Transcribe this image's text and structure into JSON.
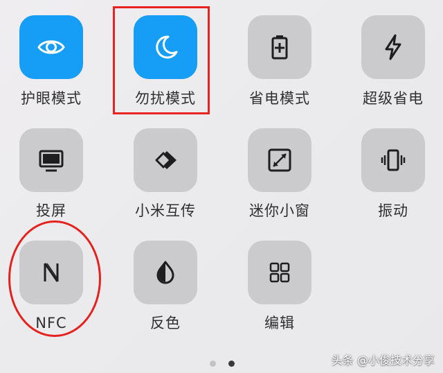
{
  "tiles": [
    {
      "label": "护眼模式",
      "icon": "eye-icon",
      "state": "on"
    },
    {
      "label": "勿扰模式",
      "icon": "moon-icon",
      "state": "on"
    },
    {
      "label": "省电模式",
      "icon": "battery-saver-icon",
      "state": "off"
    },
    {
      "label": "超级省电",
      "icon": "lightning-icon",
      "state": "off"
    },
    {
      "label": "投屏",
      "icon": "monitor-icon",
      "state": "off"
    },
    {
      "label": "小米互传",
      "icon": "mi-share-icon",
      "state": "off"
    },
    {
      "label": "迷你小窗",
      "icon": "mini-window-icon",
      "state": "off"
    },
    {
      "label": "振动",
      "icon": "vibrate-icon",
      "state": "off"
    },
    {
      "label": "NFC",
      "icon": "nfc-icon",
      "state": "off"
    },
    {
      "label": "反色",
      "icon": "invert-colors-icon",
      "state": "off"
    },
    {
      "label": "编辑",
      "icon": "grid-edit-icon",
      "state": "off"
    }
  ],
  "page_indicator": {
    "pages": 2,
    "current": 2
  },
  "watermark": "头条 @小俊技术分享",
  "colors": {
    "active_tile": "#169df6",
    "inactive_tile": "#cbcbcd",
    "highlight": "#e8221f",
    "icon_dark": "#1e1e20"
  }
}
